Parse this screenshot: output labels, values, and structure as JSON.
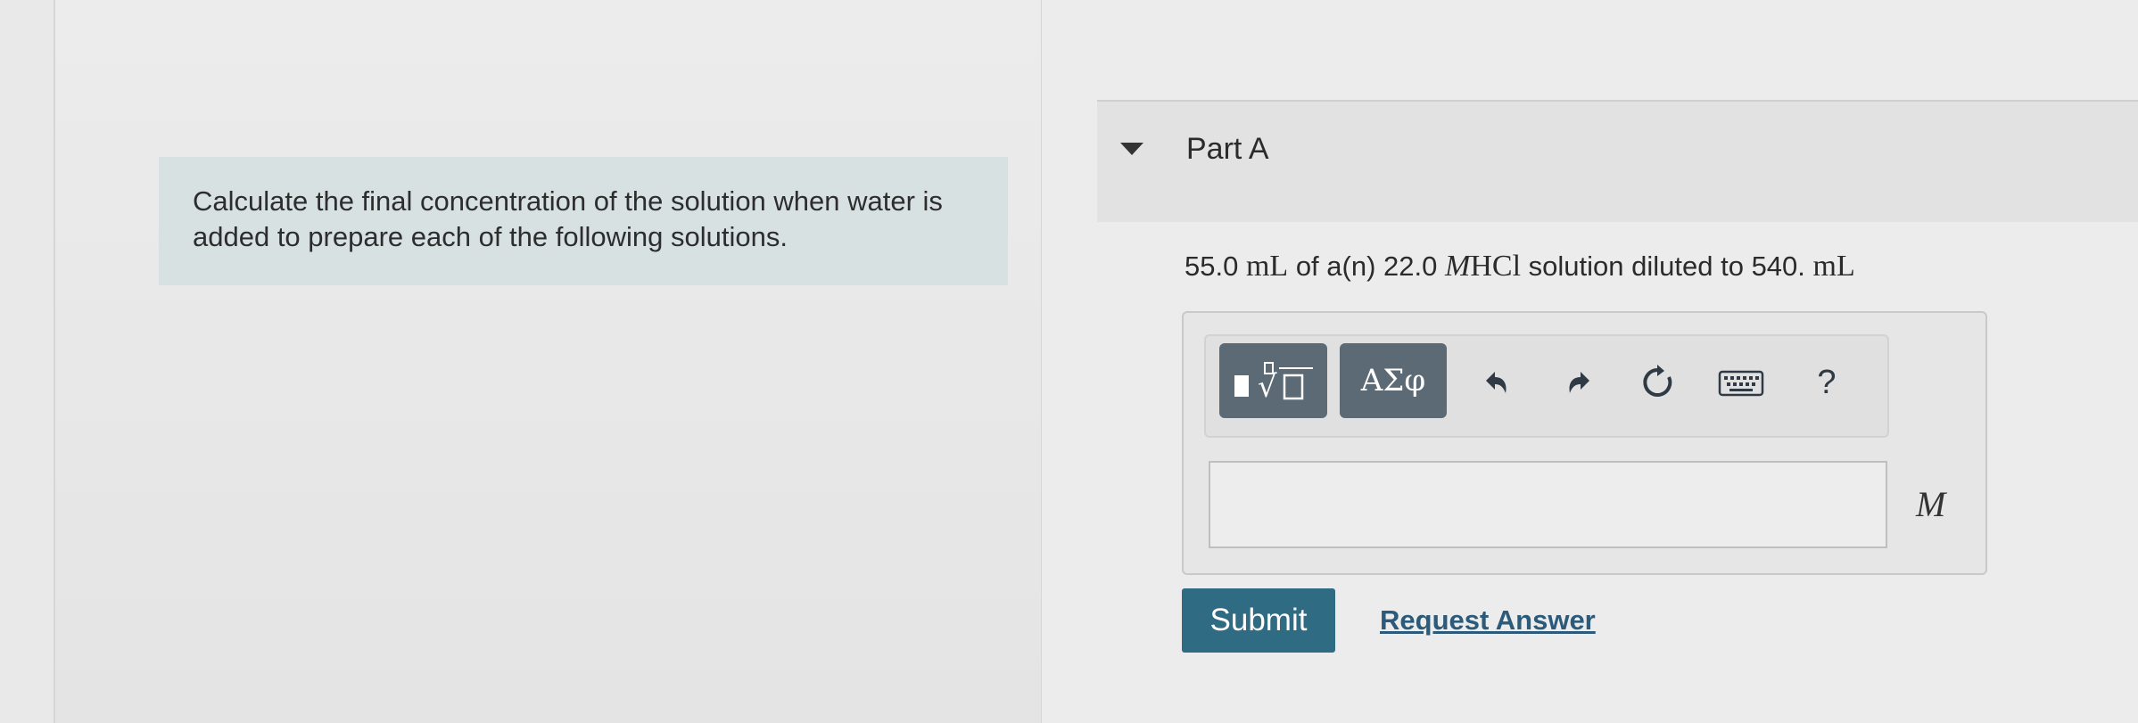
{
  "intro": {
    "text": "Calculate the final concentration of the solution when water is added to prepare each of the following solutions."
  },
  "part": {
    "title": "Part A",
    "question": {
      "volume_initial": "55.0",
      "unit_ml": "mL",
      "text_of": "of a(n)",
      "molarity": "22.0",
      "unit_m": "M",
      "solute": "HCl",
      "text_diluted": "solution diluted to",
      "volume_final": "540.",
      "unit_ml_final": "mL"
    }
  },
  "toolbar": {
    "templates_icon": "templates-icon",
    "symbols_label": "ΑΣφ",
    "undo_icon": "undo-icon",
    "redo_icon": "redo-icon",
    "reset_icon": "reset-icon",
    "keyboard_icon": "keyboard-icon",
    "help_label": "?"
  },
  "answer": {
    "value": "",
    "placeholder": "",
    "unit": "M"
  },
  "actions": {
    "submit_label": "Submit",
    "request_answer_label": "Request Answer"
  },
  "colors": {
    "intro_background": "#d7e1e1",
    "toolbar_button": "#5b6a75",
    "submit_button": "#2f6c83",
    "link": "#2c5a7a"
  }
}
